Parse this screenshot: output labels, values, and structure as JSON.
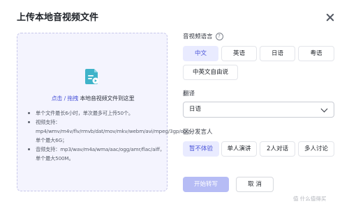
{
  "dialog": {
    "title": "上传本地音视频文件"
  },
  "upload": {
    "link_text": "点击",
    "separator": " / ",
    "drag_text": "拖拽",
    "rest_text": " 本地音视频文件到这里",
    "rules": [
      "单个文件最长6小时，单次最多可上传50个。",
      "视频支持：mp4/wmv/m4v/flv/rmvb/dat/mov/mkv/webm/avi/mpeg/3gp/ogg，单个最大6G；",
      "音频支持：mp3/wav/m4a/wma/aac/ogg/amr/flac/aiff，单个最大500M。"
    ]
  },
  "language": {
    "label": "音视频语言",
    "help": "?",
    "options": [
      "中文",
      "英语",
      "日语",
      "粤语",
      "中英文自由说"
    ],
    "selected": "中文"
  },
  "translation": {
    "label": "翻译",
    "value": "日语"
  },
  "speaker": {
    "label": "区分发言人",
    "options": [
      "暂不体验",
      "单人演讲",
      "2人对话",
      "多人讨论"
    ],
    "selected": "暂不体验"
  },
  "actions": {
    "start": "开始转写",
    "cancel": "取 消"
  },
  "watermark": "值 什么值得买",
  "colors": {
    "accent": "#4b55d9",
    "accent_light": "#e9ebff",
    "icon_teal": "#3fb3c9",
    "dropzone_bg": "#f4f4fe"
  }
}
